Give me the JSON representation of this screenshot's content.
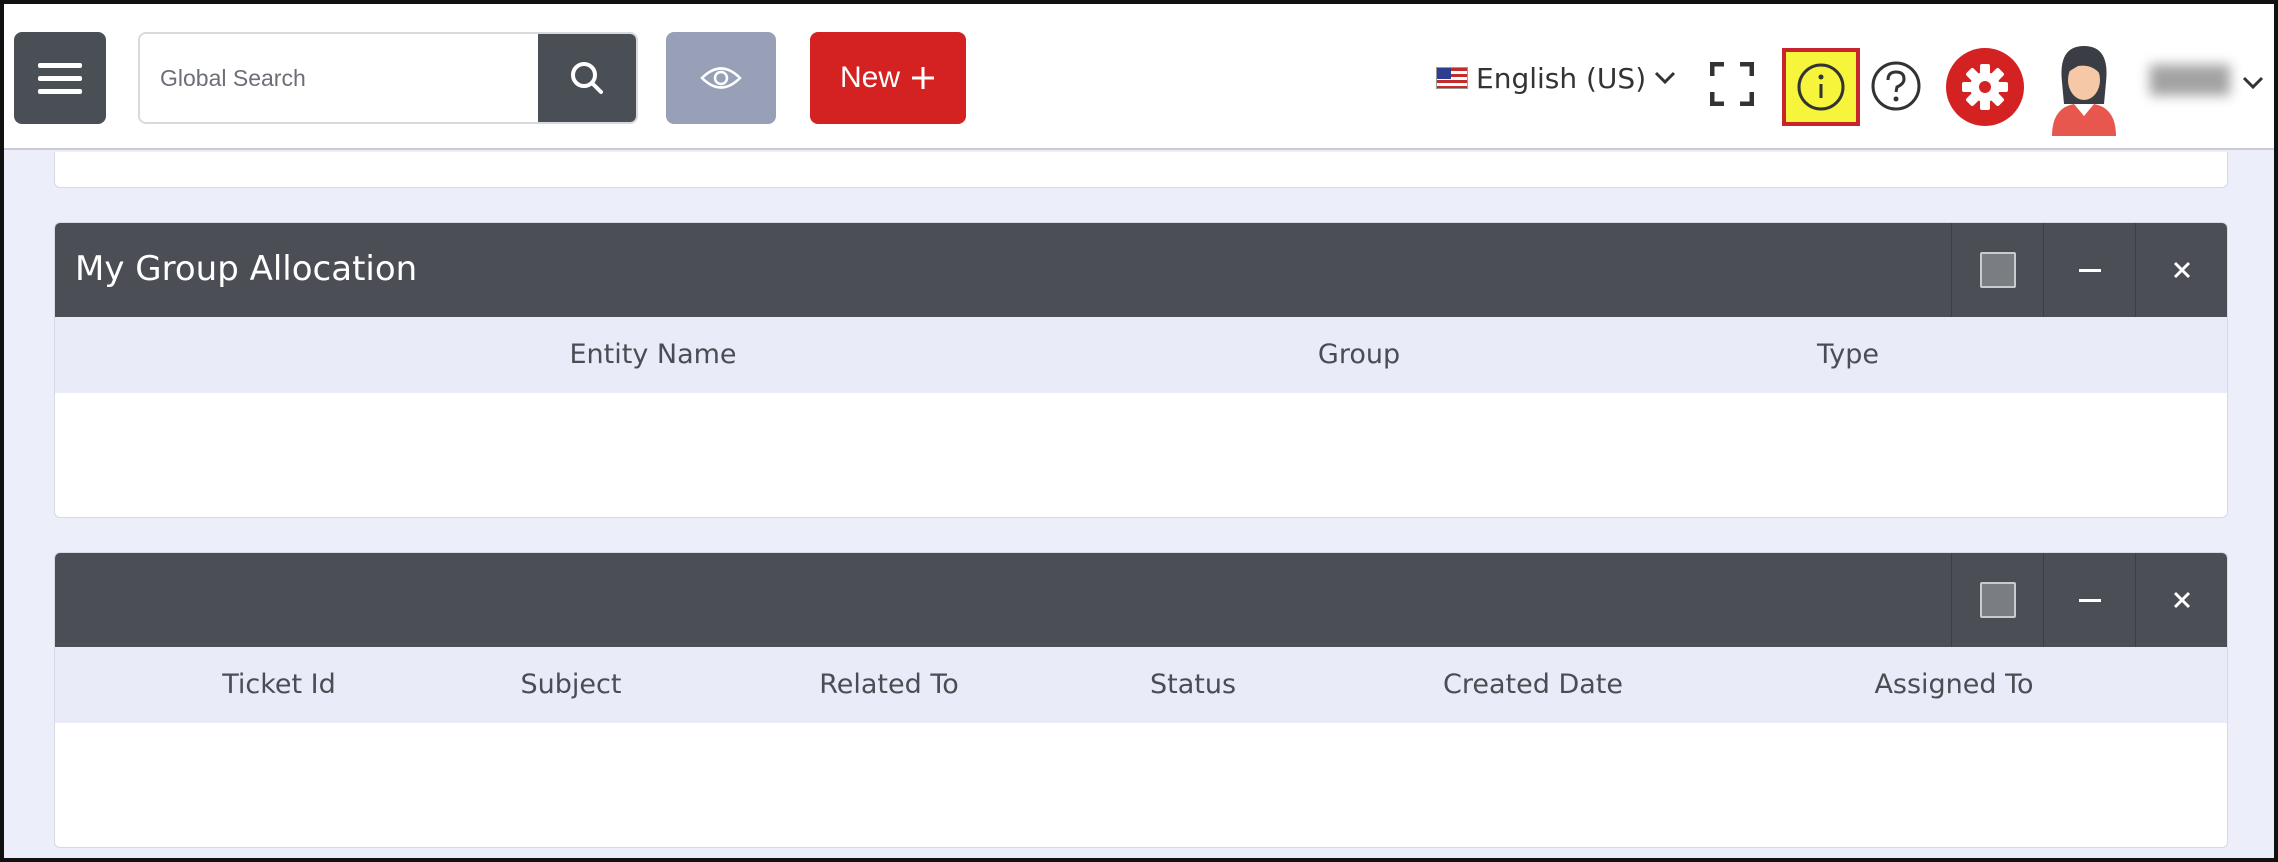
{
  "header": {
    "search_placeholder": "Global Search",
    "new_button_label": "New",
    "language": "English (US)",
    "icons": {
      "menu": "hamburger-menu-icon",
      "search": "search-icon",
      "eye": "eye-icon",
      "plus": "plus-icon",
      "flag": "us-flag-icon",
      "fullscreen": "fullscreen-icon",
      "info": "info-icon",
      "help": "help-icon",
      "settings": "gear-icon",
      "avatar": "user-avatar-icon"
    }
  },
  "panels": [
    {
      "title": "My Group Allocation",
      "columns": [
        "Entity Name",
        "Group",
        "Type"
      ],
      "rows": []
    },
    {
      "title": "",
      "columns": [
        "Ticket Id",
        "Subject",
        "Related To",
        "Status",
        "Created Date",
        "Assigned To"
      ],
      "rows": []
    }
  ],
  "colors": {
    "header_dark": "#4a4f55",
    "accent_red": "#d42222",
    "info_highlight": "#f6f53b",
    "info_border": "#c8242b",
    "eye_button": "#98a0b8",
    "table_header_bg": "#e9ecf8",
    "page_bg": "#eceef9"
  }
}
